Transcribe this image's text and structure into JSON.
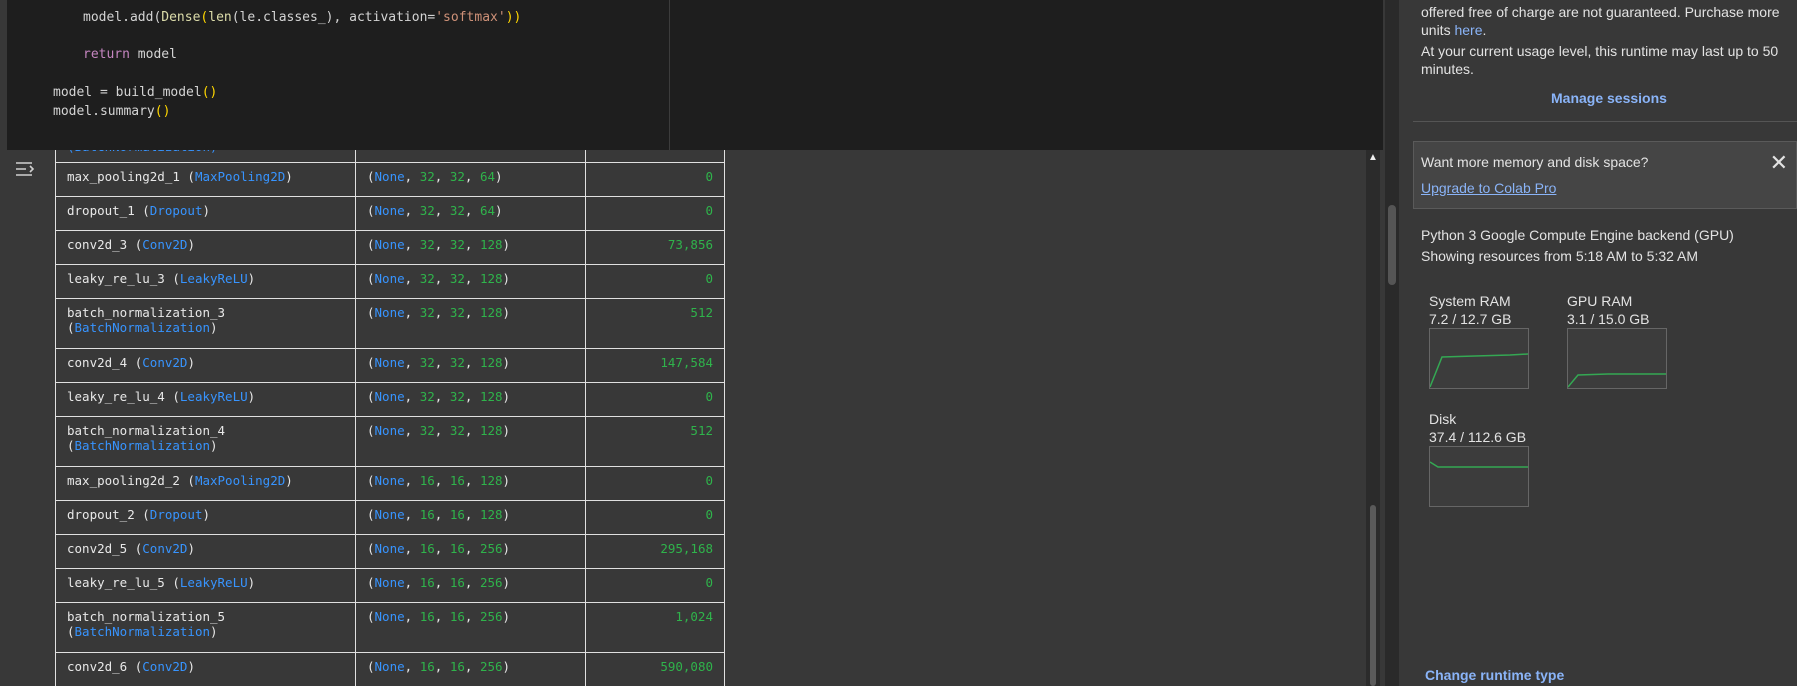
{
  "code": {
    "lines": [
      [
        "    model.add(",
        "Dense",
        "(",
        "len",
        "(le.classes_), activation=",
        "'softmax'",
        "))"
      ],
      [
        "    return model"
      ],
      [
        "model = build_model",
        "()"
      ],
      [
        "model.summary",
        "()"
      ]
    ],
    "line1_a": "model.add(",
    "line1_b": "Dense",
    "line1_c": "(",
    "line1_d": "len",
    "line1_e": "(le.classes_), activation=",
    "line1_f": "'softmax'",
    "line1_g": "))",
    "line2_kw": "return",
    "line2_rest": " model",
    "line3_a": "model = build_model",
    "line3_b": "()",
    "line4_a": "model.summary",
    "line4_b": "()"
  },
  "summary": {
    "partial_row_class": "(BatchNormalization)",
    "rows": [
      {
        "name": "max_pooling2d_1",
        "cls": "MaxPooling2D",
        "shape": [
          "32",
          "32",
          "64"
        ],
        "params": "0"
      },
      {
        "name": "dropout_1",
        "cls": "Dropout",
        "shape": [
          "32",
          "32",
          "64"
        ],
        "params": "0"
      },
      {
        "name": "conv2d_3",
        "cls": "Conv2D",
        "shape": [
          "32",
          "32",
          "128"
        ],
        "params": "73,856"
      },
      {
        "name": "leaky_re_lu_3",
        "cls": "LeakyReLU",
        "shape": [
          "32",
          "32",
          "128"
        ],
        "params": "0"
      },
      {
        "name": "batch_normalization_3",
        "cls": "BatchNormalization",
        "shape": [
          "32",
          "32",
          "128"
        ],
        "params": "512"
      },
      {
        "name": "conv2d_4",
        "cls": "Conv2D",
        "shape": [
          "32",
          "32",
          "128"
        ],
        "params": "147,584"
      },
      {
        "name": "leaky_re_lu_4",
        "cls": "LeakyReLU",
        "shape": [
          "32",
          "32",
          "128"
        ],
        "params": "0"
      },
      {
        "name": "batch_normalization_4",
        "cls": "BatchNormalization",
        "shape": [
          "32",
          "32",
          "128"
        ],
        "params": "512"
      },
      {
        "name": "max_pooling2d_2",
        "cls": "MaxPooling2D",
        "shape": [
          "16",
          "16",
          "128"
        ],
        "params": "0"
      },
      {
        "name": "dropout_2",
        "cls": "Dropout",
        "shape": [
          "16",
          "16",
          "128"
        ],
        "params": "0"
      },
      {
        "name": "conv2d_5",
        "cls": "Conv2D",
        "shape": [
          "16",
          "16",
          "256"
        ],
        "params": "295,168"
      },
      {
        "name": "leaky_re_lu_5",
        "cls": "LeakyReLU",
        "shape": [
          "16",
          "16",
          "256"
        ],
        "params": "0"
      },
      {
        "name": "batch_normalization_5",
        "cls": "BatchNormalization",
        "shape": [
          "16",
          "16",
          "256"
        ],
        "params": "1,024"
      },
      {
        "name": "conv2d_6",
        "cls": "Conv2D",
        "shape": [
          "16",
          "16",
          "256"
        ],
        "params": "590,080"
      }
    ],
    "none_label": "None"
  },
  "panel": {
    "text1": "offered free of charge are not guaranteed. Purchase more",
    "text2_a": "units ",
    "text2_link": "here",
    "text2_b": ".",
    "text3": "At your current usage level, this runtime may last up to 50",
    "text4": "minutes.",
    "manage_sessions": "Manage sessions",
    "upsell_question": "Want more memory and disk space?",
    "upsell_link": "Upgrade to Colab Pro",
    "backend": "Python 3 Google Compute Engine backend (GPU)",
    "showing": "Showing resources from 5:18 AM to 5:32 AM",
    "system_ram_label": "System RAM",
    "system_ram_value": "7.2 / 12.7 GB",
    "gpu_ram_label": "GPU RAM",
    "gpu_ram_value": "3.1 / 15.0 GB",
    "disk_label": "Disk",
    "disk_value": "37.4 / 112.6 GB",
    "change_runtime": "Change runtime type"
  },
  "colors": {
    "accent_link": "#8ab4f8",
    "graph_line": "#34a853",
    "class_blue": "#3794ff",
    "number_green": "#2fb34b"
  },
  "icons": {
    "output_toggle": "output-toggle-icon",
    "close": "close-icon",
    "scroll_up": "chevron-up-icon"
  }
}
